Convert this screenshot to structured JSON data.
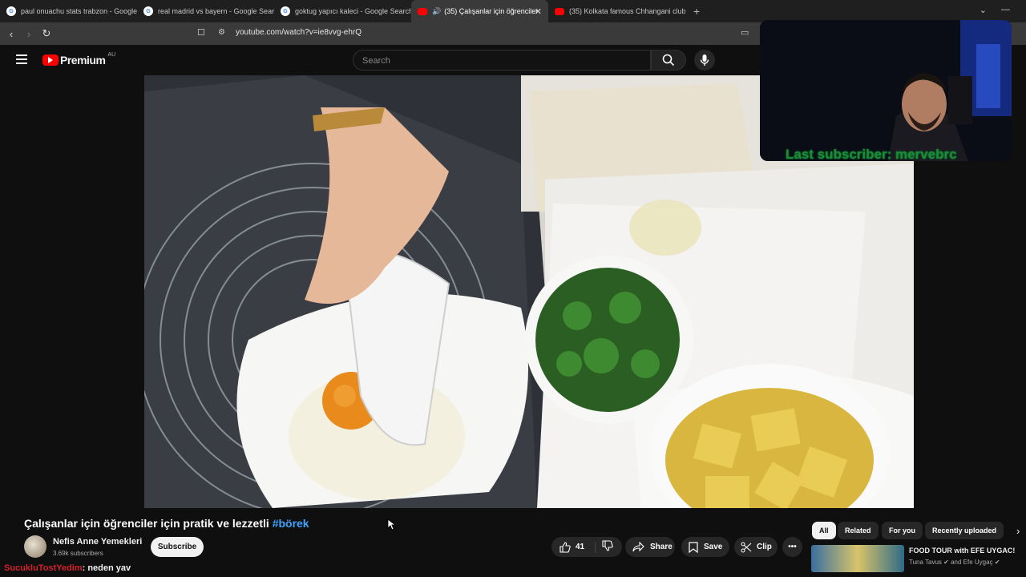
{
  "browser": {
    "tabs": [
      {
        "title": "paul onuachu stats trabzon - Google",
        "icon": "google-icon"
      },
      {
        "title": "real madrid vs bayern - Google Searc",
        "icon": "google-icon"
      },
      {
        "title": "goktug yapıcı kaleci - Google Search",
        "icon": "google-icon"
      },
      {
        "title": "(35) Çalışanlar için öğrenciler",
        "icon": "youtube-icon",
        "active": true
      },
      {
        "title": "(35) Kolkata famous Chhangani club",
        "icon": "youtube-icon"
      }
    ],
    "url": "youtube.com/watch?v=ie8vvg-ehrQ"
  },
  "youtube": {
    "logo": "Premium",
    "region": "AU",
    "search_placeholder": "Search"
  },
  "stream_overlay": {
    "text": "Last subscriber: mervebrc"
  },
  "video": {
    "title": "Çalışanlar için öğrenciler için pratik ve lezzetli",
    "hashtag": "#börek",
    "channel": "Nefis Anne Yemekleri",
    "subscribers": "3.69k subscribers",
    "subscribe_label": "Subscribe",
    "likes": "41",
    "share_label": "Share",
    "save_label": "Save",
    "clip_label": "Clip"
  },
  "chips": [
    "All",
    "Related",
    "For you",
    "Recently uploaded"
  ],
  "recommended": {
    "title": "FOOD TOUR with EFE UYGAC!",
    "channels": "Tuna Tavus",
    "channels_rest": "and Efe Uygaç"
  },
  "chat": {
    "user": "SucukluTostYedim",
    "message": ": neden yav"
  }
}
